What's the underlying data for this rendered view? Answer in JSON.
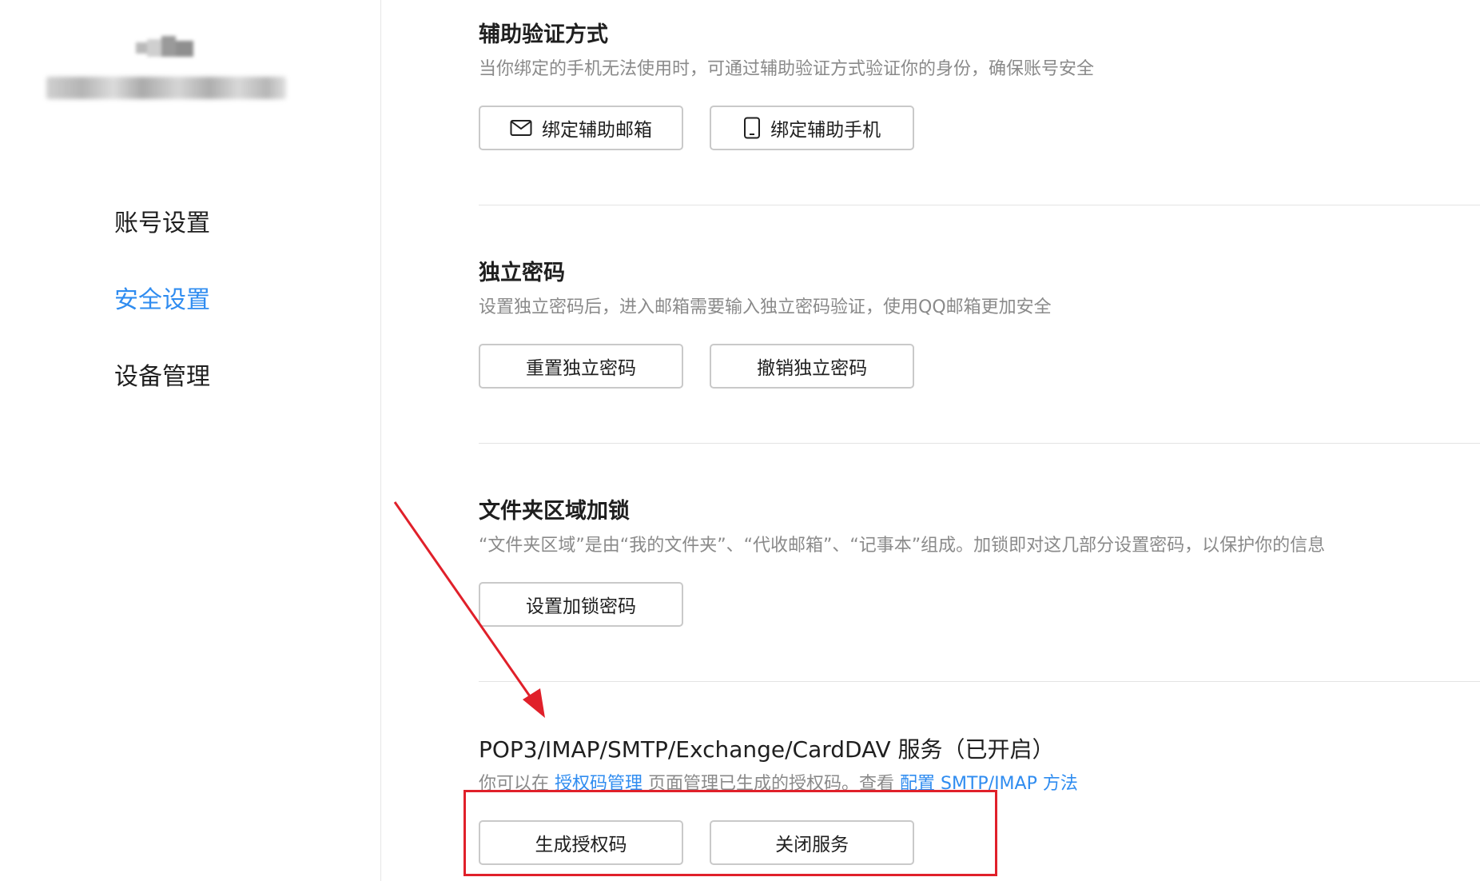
{
  "sidebar": {
    "nav": [
      {
        "label": "账号设置",
        "active": false
      },
      {
        "label": "安全设置",
        "active": true
      },
      {
        "label": "设备管理",
        "active": false
      }
    ]
  },
  "sections": {
    "aux_verify": {
      "title": "辅助验证方式",
      "desc": "当你绑定的手机无法使用时，可通过辅助验证方式验证你的身份，确保账号安全",
      "buttons": {
        "bind_email": "绑定辅助邮箱",
        "bind_phone": "绑定辅助手机"
      }
    },
    "independent_password": {
      "title": "独立密码",
      "desc": "设置独立密码后，进入邮箱需要输入独立密码验证，使用QQ邮箱更加安全",
      "buttons": {
        "reset": "重置独立密码",
        "revoke": "撤销独立密码"
      }
    },
    "folder_lock": {
      "title": "文件夹区域加锁",
      "desc": "“文件夹区域”是由“我的文件夹”、“代收邮箱”、“记事本”组成。加锁即对这几部分设置密码，以保护你的信息",
      "buttons": {
        "set_lock": "设置加锁密码"
      }
    },
    "services": {
      "title": "POP3/IMAP/SMTP/Exchange/CardDAV 服务（已开启）",
      "desc_prefix": "你可以在 ",
      "desc_link_auth": "授权码管理",
      "desc_middle": " 页面管理已生成的授权码。查看 ",
      "desc_link_config": "配置 SMTP/IMAP 方法",
      "buttons": {
        "generate": "生成授权码",
        "close": "关闭服务"
      }
    }
  },
  "colors": {
    "accent": "#2f8cf0",
    "annotation": "#e0202a",
    "muted_text": "#8a8a8a",
    "border": "#c9c9c9"
  },
  "icons": {
    "bind_email": "mail-icon",
    "bind_phone": "phone-icon"
  }
}
